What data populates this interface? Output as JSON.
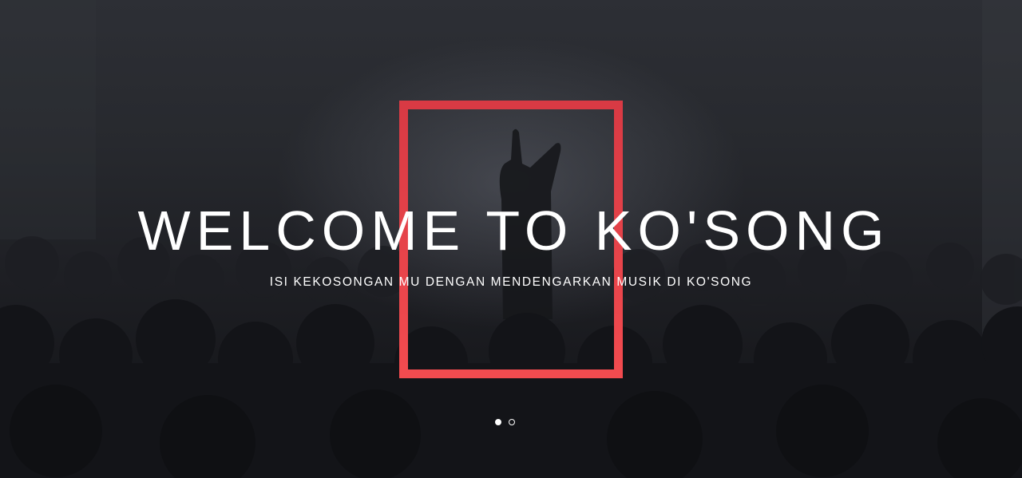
{
  "hero": {
    "title": "WELCOME TO KO'SONG",
    "subtitle": "ISI KEKOSONGAN MU DENGAN MENDENGARKAN MUSIK DI KO'SONG",
    "background": "concert-crowd-photo",
    "frame_color": "#e8434a"
  },
  "carousel": {
    "slides": [
      {
        "label": "Slide 1",
        "active": true
      },
      {
        "label": "Slide 2",
        "active": false
      }
    ]
  }
}
